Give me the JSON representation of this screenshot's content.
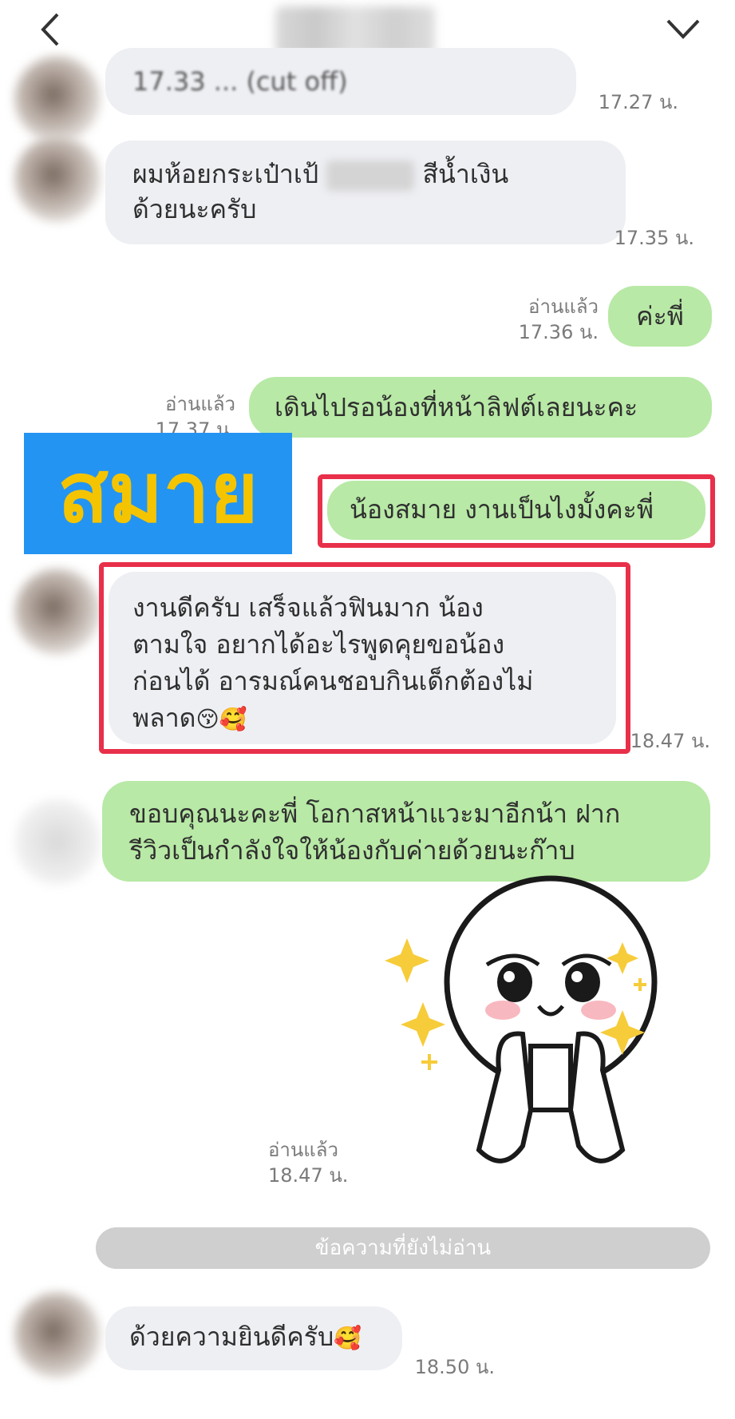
{
  "header": {
    "back_icon": "chevron-left-icon",
    "menu_icon": "chevron-down-icon"
  },
  "highlight_label": "สมาย",
  "messages": [
    {
      "side": "in",
      "text": "17.33 ... (cut off)",
      "time": "17.27 น."
    },
    {
      "side": "in",
      "text_a": "ผมห้อยกระเป๋าเป้",
      "text_b": "สีน้ำเงิน",
      "text_c": "ด้วยนะครับ",
      "time": "17.35 น."
    },
    {
      "side": "out",
      "text": "ค่ะพี่",
      "read": "อ่านแล้ว",
      "time": "17.36 น."
    },
    {
      "side": "out",
      "text": "เดินไปรอน้องที่หน้าลิฟต์เลยนะคะ",
      "read": "อ่านแล้ว",
      "time": "17.37 น."
    },
    {
      "side": "out",
      "text": "น้องสมาย งานเป็นไงมั้งคะพี่"
    },
    {
      "side": "in",
      "lines": [
        "งานดีครับ เสร็จแล้วฟินมาก น้อง",
        "ตามใจ อยากได้อะไรพูดคุยขอน้อง",
        "ก่อนได้ อารมณ์คนชอบกินเด็กต้องไม่",
        "พลาด"
      ],
      "emoji": "😚🥰",
      "time": "18.47 น."
    },
    {
      "side": "out",
      "lines": [
        "ขอบคุณนะคะพี่ โอกาสหน้าแวะมาอีกน้า ฝาก",
        "รีวิวเป็นกำลังใจให้น้องกับค่ายด้วยนะก๊าบ"
      ]
    },
    {
      "side": "out",
      "sticker": "smiling-face-sticker",
      "read": "อ่านแล้ว",
      "time": "18.47 น."
    },
    {
      "side": "in",
      "text": "ด้วยความยินดีครับ",
      "emoji": "🥰",
      "time": "18.50 น."
    }
  ],
  "unread_divider": "ข้อความที่ยังไม่อ่าน",
  "colors": {
    "out_bubble": "#b8e9a6",
    "in_bubble": "#eeeff3",
    "highlight": "#e8304a",
    "tag_bg": "#2394f2",
    "tag_text": "#f4c400"
  }
}
